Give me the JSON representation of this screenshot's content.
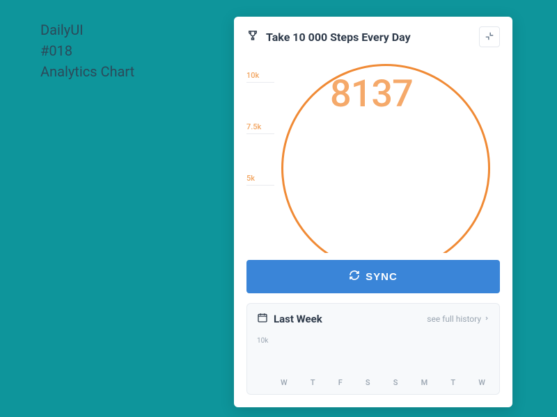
{
  "page_label": {
    "line1": "DailyUI",
    "line2": "#018",
    "line3": "Analytics Chart"
  },
  "card": {
    "title": "Take 10 000 Steps Every Day",
    "steps_value": "8137",
    "sync_label": "SYNC"
  },
  "main_axis": {
    "t0": "10k",
    "t1": "7.5k",
    "t2": "5k"
  },
  "history": {
    "title": "Last Week",
    "link_label": "see full history",
    "ytick": "10k",
    "days": [
      "W",
      "T",
      "F",
      "S",
      "S",
      "M",
      "T",
      "W"
    ]
  },
  "chart_data": {
    "type": "bar",
    "title": "Take 10 000 Steps Every Day",
    "today_value": 8137,
    "goal": 10000,
    "yticks": [
      5000,
      7500,
      10000
    ],
    "ylim": [
      0,
      10000
    ],
    "history": {
      "title": "Last Week",
      "categories": [
        "W",
        "T",
        "F",
        "S",
        "S",
        "M",
        "T",
        "W"
      ],
      "values": [
        null,
        null,
        null,
        null,
        null,
        null,
        null,
        null
      ],
      "ylim": [
        0,
        10000
      ]
    }
  }
}
